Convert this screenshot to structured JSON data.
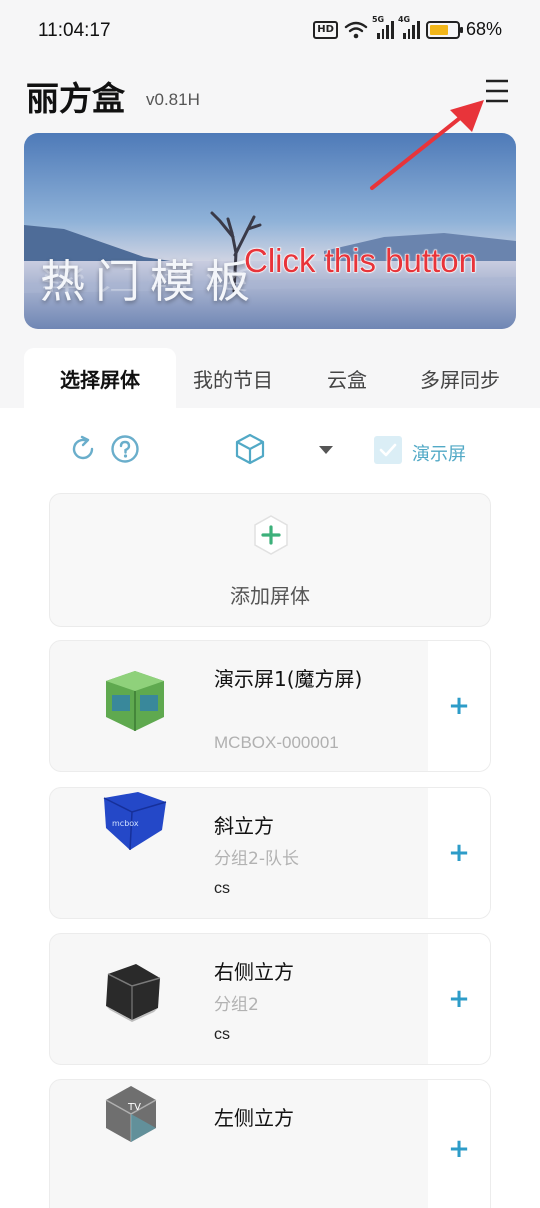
{
  "status_bar": {
    "time": "11:04:17",
    "hd": "HD",
    "sig1_label": "5G",
    "sig2_label": "4G",
    "battery_level": 0.68,
    "battery_text": "68%"
  },
  "header": {
    "title": "丽方盒",
    "version": "v0.81H"
  },
  "banner": {
    "title": "热门模板"
  },
  "annotation": {
    "text": "Click this button",
    "color": "#e8343a"
  },
  "tabs": [
    {
      "label": "选择屏体",
      "active": true
    },
    {
      "label": "我的节目"
    },
    {
      "label": "云盒"
    },
    {
      "label": "多屏同步"
    }
  ],
  "toolbar": {
    "demo_label": "演示屏",
    "accent": "#52a9c6"
  },
  "add_card": {
    "label": "添加屏体"
  },
  "devices": [
    {
      "name": "演示屏1(魔方屏)",
      "code": "MCBOX-000001",
      "icon": "green-cube-icon"
    },
    {
      "name": "斜立方",
      "group": "分组2-队长",
      "note": "cs",
      "icon": "blue-cube-icon"
    },
    {
      "name": "右侧立方",
      "group": "分组2",
      "note": "cs",
      "icon": "black-cube-icon"
    },
    {
      "name": "左侧立方",
      "icon": "tv-cube-icon"
    }
  ],
  "icons": {
    "menu": "menu-icon",
    "refresh": "refresh-icon",
    "help": "help-icon",
    "cube": "cube-icon",
    "dropdown": "caret-down-icon",
    "add": "add-hexagon-icon",
    "plus": "+"
  }
}
